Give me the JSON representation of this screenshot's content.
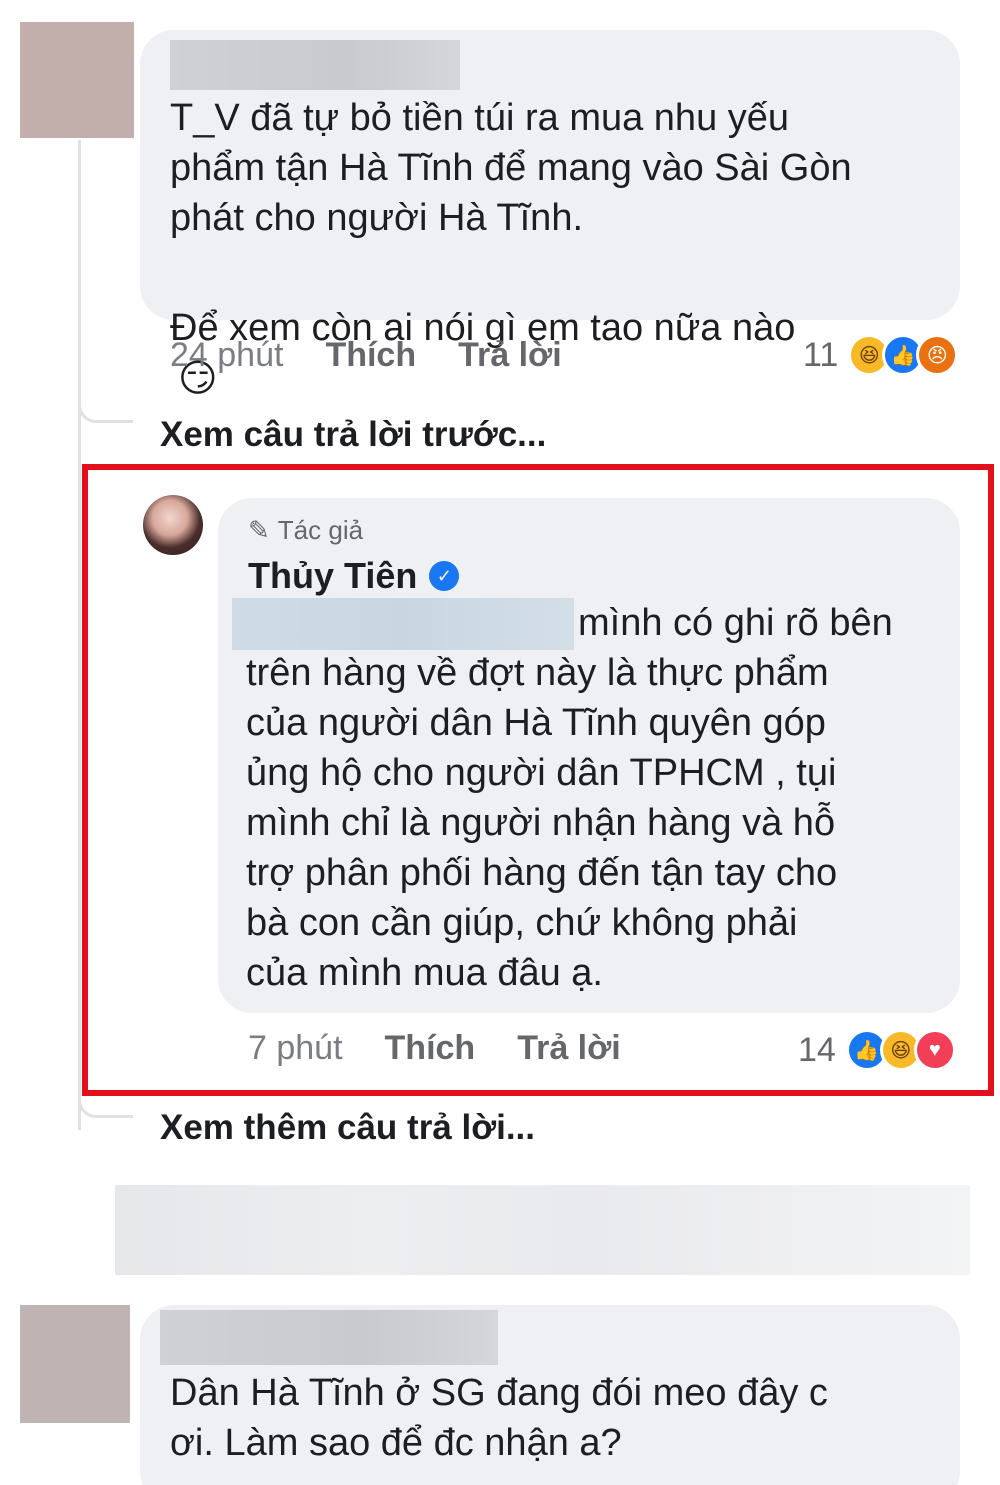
{
  "comment1": {
    "text_line1": "T_V đã tự bỏ tiền túi ra mua nhu yếu",
    "text_line2": "phẩm tận Hà Tĩnh để mang vào Sài Gòn",
    "text_line3": "phát cho người Hà Tĩnh.",
    "text_line4": "Để xem còn ai nói gì em tao nữa nào",
    "emoji": "😏",
    "time": "24 phút",
    "like_label": "Thích",
    "reply_label": "Trả lời",
    "reaction_count": "11",
    "reactions": [
      "haha-icon",
      "like-icon",
      "angry-icon"
    ]
  },
  "view_previous_replies": "Xem câu trả lời trước...",
  "reply": {
    "author_tag": "Tác giả",
    "author_name": "Thủy Tiên",
    "text_line1": "mình có ghi rõ bên",
    "text_line2": "trên hàng về đợt này là thực phẩm",
    "text_line3": "của người dân Hà Tĩnh quyên góp",
    "text_line4": "ủng hộ cho người dân TPHCM , tụi",
    "text_line5": "mình chỉ là người nhận hàng và hỗ",
    "text_line6": "trợ phân phối hàng đến tận tay cho",
    "text_line7": "bà con cần giúp, chứ không phải",
    "text_line8": "của mình mua đâu ạ.",
    "time": "7 phút",
    "like_label": "Thích",
    "reply_label": "Trả lời",
    "reaction_count": "14",
    "reactions": [
      "like-icon",
      "haha-icon",
      "love-icon"
    ]
  },
  "view_more_replies": "Xem thêm câu trả lời...",
  "comment2": {
    "text_line1": "Dân Hà Tĩnh ở SG đang đói meo đây c",
    "text_line2": "ơi. Làm sao để đc nhận a?"
  },
  "colors": {
    "highlight": "#e3101b",
    "bubble": "#eef0f3",
    "facebook_blue": "#1877f2"
  }
}
